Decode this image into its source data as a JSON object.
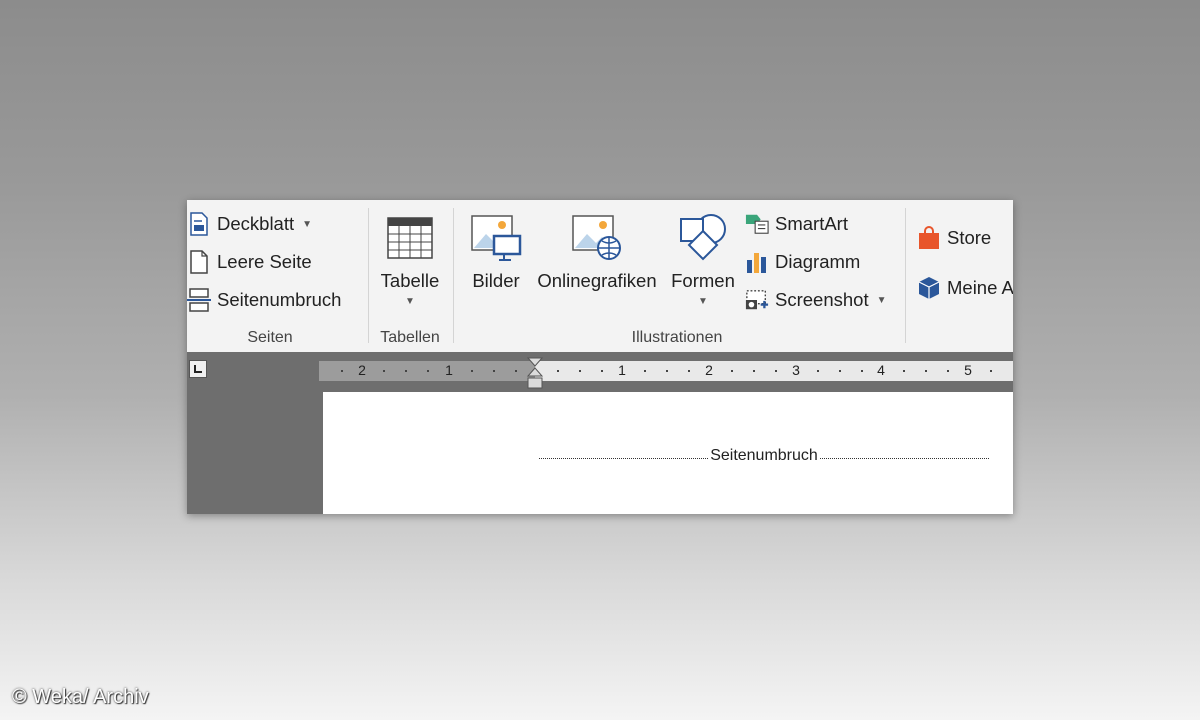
{
  "ribbon": {
    "seiten": {
      "label": "Seiten",
      "deckblatt": "Deckblatt",
      "leere_seite": "Leere Seite",
      "seitenumbruch": "Seitenumbruch"
    },
    "tabellen": {
      "label": "Tabellen",
      "tabelle": "Tabelle"
    },
    "illustrationen": {
      "label": "Illustrationen",
      "bilder": "Bilder",
      "onlinegrafiken": "Onlinegrafiken",
      "formen": "Formen",
      "smartart": "SmartArt",
      "diagramm": "Diagramm",
      "screenshot": "Screenshot"
    },
    "addins": {
      "store": "Store",
      "meine_addins": "Meine A"
    },
    "colors": {
      "ribbon_bg": "#f3f3f3",
      "accent_blue": "#2b579a",
      "store_orange": "#e8552b",
      "smartart_green": "#3aa57a"
    }
  },
  "ruler": {
    "numbers": [
      "2",
      "1",
      "1",
      "2",
      "3",
      "4",
      "5"
    ]
  },
  "document": {
    "page_break_text": "Seitenumbruch",
    "pilcrow": "¶"
  },
  "footer": {
    "copyright": "© Weka/ Archiv"
  }
}
